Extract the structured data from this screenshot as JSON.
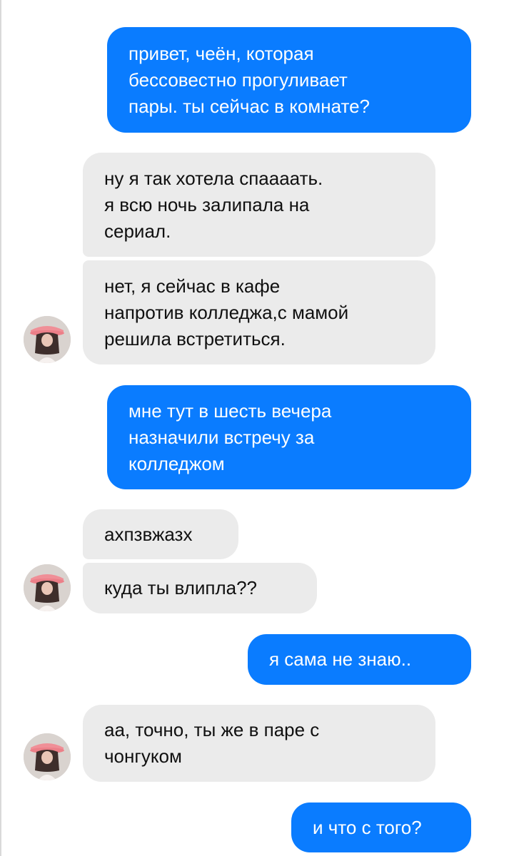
{
  "conversation": {
    "messages": [
      {
        "side": "sent",
        "text": "привет, чеён, которая\nбессовестно прогуливает\nпары. ты сейчас в комнате?"
      },
      {
        "side": "received",
        "text": "ну я так хотела спаааать.\nя всю ночь залипала на\nсериал."
      },
      {
        "side": "received",
        "text": "нет, я сейчас в кафе\nнапротив колледжа,с мамой\nрешила встретиться."
      },
      {
        "side": "sent",
        "text": "мне тут в шесть вечера\nназначили встречу за\nколледжом"
      },
      {
        "side": "received",
        "text": "ахпзвжазх"
      },
      {
        "side": "received",
        "text": "куда ты влипла??"
      },
      {
        "side": "sent",
        "text": "я сама не знаю.."
      },
      {
        "side": "received",
        "text": "аа, точно, ты же в паре с\nчонгуком"
      },
      {
        "side": "sent",
        "text": "и что с того?"
      }
    ]
  },
  "colors": {
    "sent_bubble": "#0a7cff",
    "received_bubble": "#ebebeb",
    "background": "#ffffff"
  },
  "icons": {
    "avatar": "contact-avatar-pink-bucket-hat"
  }
}
